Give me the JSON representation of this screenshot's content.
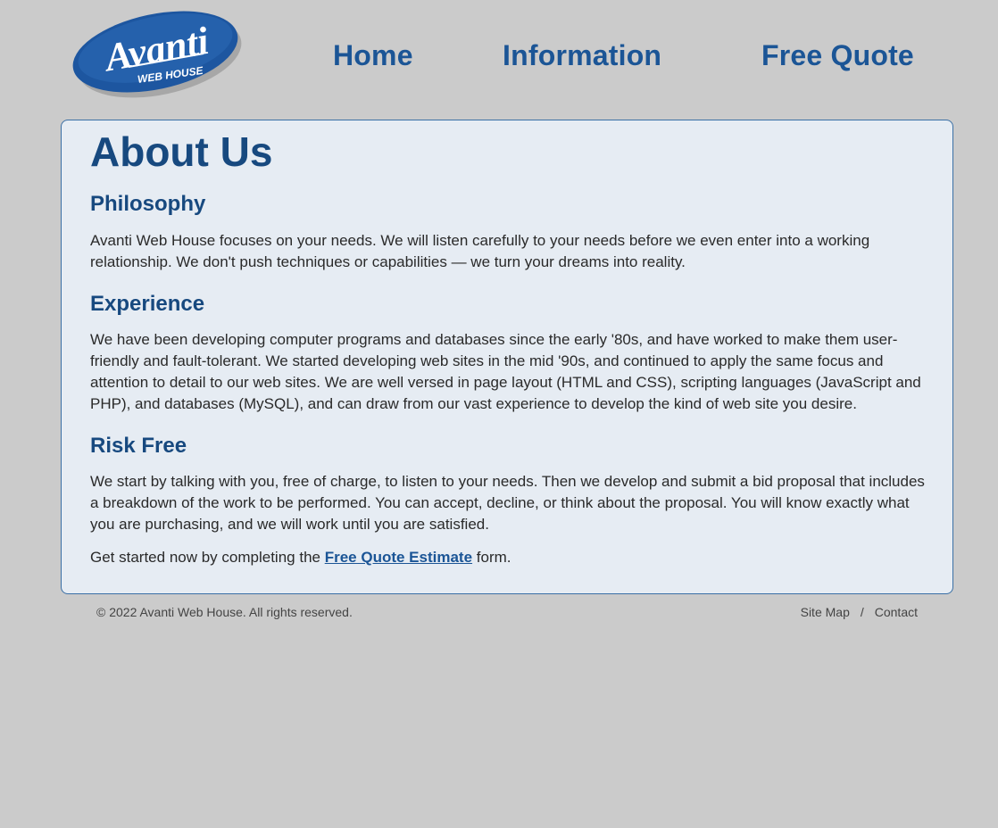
{
  "logo": {
    "main": "Avanti",
    "sub": "WEB HOUSE"
  },
  "nav": {
    "home": "Home",
    "information": "Information",
    "free_quote": "Free Quote"
  },
  "main": {
    "title": "About Us",
    "sections": [
      {
        "heading": "Philosophy",
        "text": "Avanti Web House focuses on your needs. We will listen carefully to your needs before we even enter into a working relationship. We don't push techniques or capabilities — we turn your dreams into reality."
      },
      {
        "heading": "Experience",
        "text": "We have been developing computer programs and databases since the early '80s, and have worked to make them user-friendly and fault-tolerant. We started developing web sites in the mid '90s, and continued to apply the same focus and attention to detail to our web sites. We are well versed in page layout (HTML and CSS), scripting languages (JavaScript and PHP), and databases (MySQL), and can draw from our vast experience to develop the kind of web site you desire."
      },
      {
        "heading": "Risk Free",
        "text": "We start by talking with you, free of charge, to listen to your needs. Then we develop and submit a bid proposal that includes a breakdown of the work to be performed. You can accept, decline, or think about the proposal. You will know exactly what you are purchasing, and we will work until you are satisfied."
      }
    ],
    "cta": {
      "before": "Get started now by completing the",
      "link": "Free Quote Estimate",
      "after": "form."
    }
  },
  "footer": {
    "copyright": "© 2022 Avanti Web House. All rights reserved.",
    "site_map": "Site Map",
    "separator": "/",
    "contact": "Contact"
  },
  "colors": {
    "brand": "#1b5596",
    "heading": "#17497f",
    "panel_bg": "#e6ecf3",
    "page_bg": "#cbcbcb"
  }
}
